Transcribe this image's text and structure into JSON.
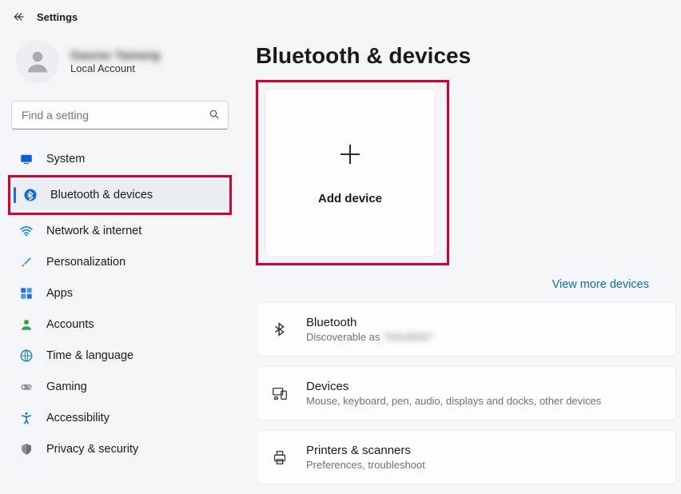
{
  "header": {
    "title": "Settings"
  },
  "account": {
    "name": "Gaurav Tamang",
    "sub": "Local Account"
  },
  "search": {
    "placeholder": "Find a setting"
  },
  "nav": {
    "items": [
      {
        "label": "System"
      },
      {
        "label": "Bluetooth & devices"
      },
      {
        "label": "Network & internet"
      },
      {
        "label": "Personalization"
      },
      {
        "label": "Apps"
      },
      {
        "label": "Accounts"
      },
      {
        "label": "Time & language"
      },
      {
        "label": "Gaming"
      },
      {
        "label": "Accessibility"
      },
      {
        "label": "Privacy & security"
      }
    ]
  },
  "main": {
    "title": "Bluetooth & devices",
    "add_device": "Add device",
    "view_more": "View more devices",
    "cards": {
      "bluetooth": {
        "title": "Bluetooth",
        "sub_prefix": "Discoverable as ",
        "sub_blur": "\"GAURAV\""
      },
      "devices": {
        "title": "Devices",
        "sub": "Mouse, keyboard, pen, audio, displays and docks, other devices"
      },
      "printers": {
        "title": "Printers & scanners",
        "sub": "Preferences, troubleshoot"
      }
    }
  }
}
